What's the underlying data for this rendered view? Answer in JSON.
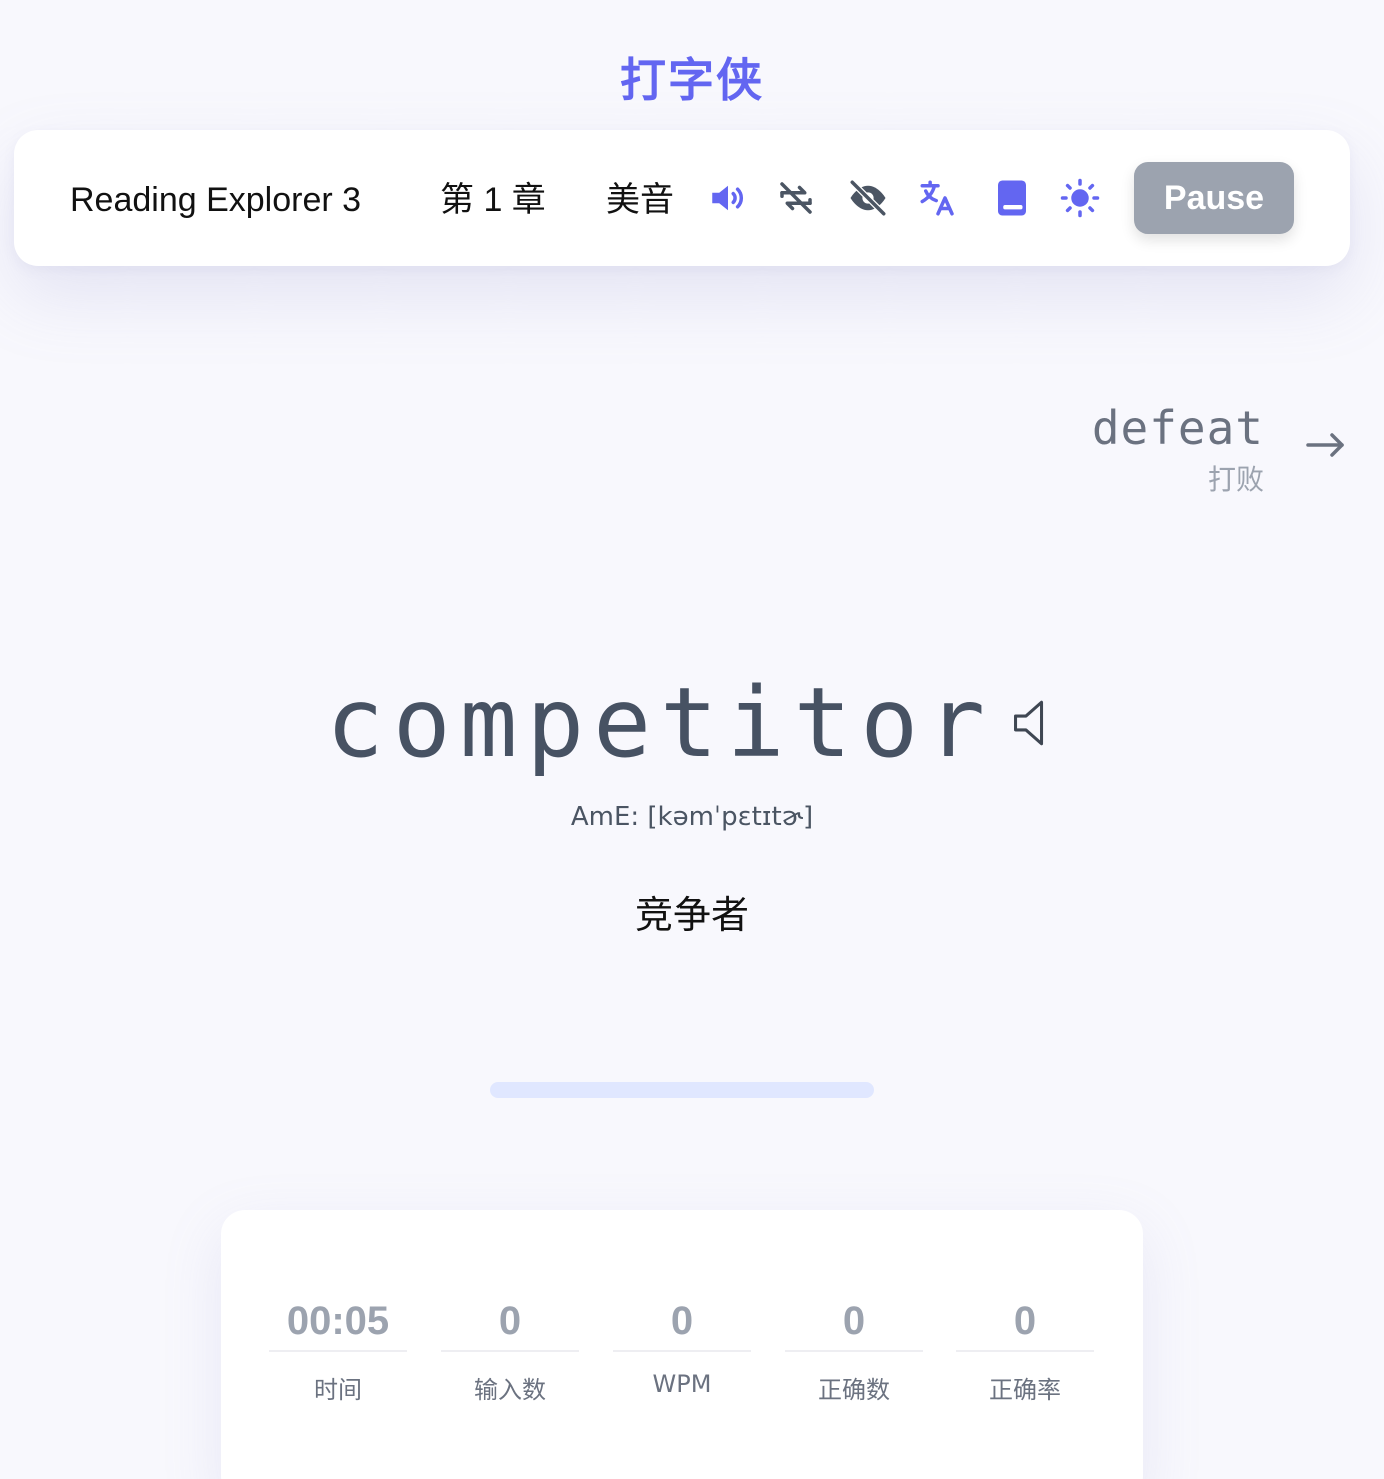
{
  "app": {
    "title": "打字侠"
  },
  "toolbar": {
    "dictionary": "Reading Explorer 3",
    "chapter": "第 1 章",
    "accent": "美音",
    "icons": [
      "speaker-icon",
      "loop-off-icon",
      "eye-off-icon",
      "translate-icon",
      "book-icon",
      "sun-icon"
    ],
    "pause_label": "Pause",
    "accent_color": "#6366f1"
  },
  "next_word": {
    "word": "defeat",
    "translation": "打败"
  },
  "current_word": {
    "word": "competitor",
    "phonetic": "AmE: [kəmˈpɛtɪtɚ]",
    "translation": "竞争者"
  },
  "progress": {
    "fraction": 0
  },
  "stats": [
    {
      "value": "00:05",
      "label": "时间"
    },
    {
      "value": "0",
      "label": "输入数"
    },
    {
      "value": "0",
      "label": "WPM"
    },
    {
      "value": "0",
      "label": "正确数"
    },
    {
      "value": "0",
      "label": "正确率"
    }
  ]
}
